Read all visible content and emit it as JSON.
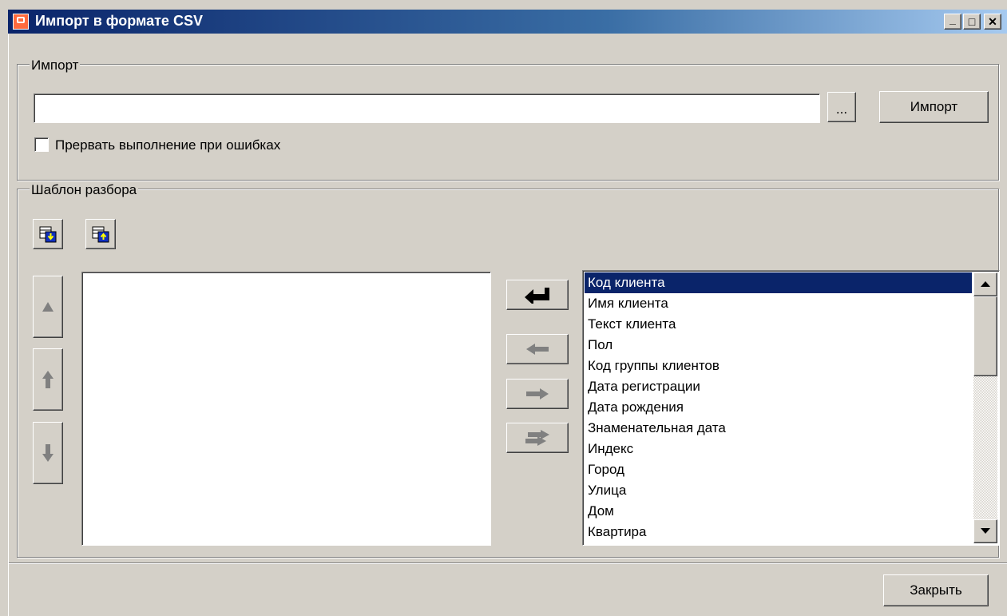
{
  "window": {
    "title": "Импорт в формате CSV",
    "minimize": "_",
    "maximize": "□",
    "close": "✕"
  },
  "import_group": {
    "label": "Импорт",
    "file_path_value": "",
    "browse_label": "...",
    "import_label": "Импорт",
    "abort_on_errors_label": "Прервать выполнение при ошибках",
    "abort_on_errors_checked": false
  },
  "template_group": {
    "label": "Шаблон разбора",
    "load_template_icon": "load-template-icon",
    "save_template_icon": "save-template-icon",
    "selected_fields": [],
    "available_fields": [
      "Код клиента",
      "Имя клиента",
      "Текст клиента",
      "Пол",
      "Код группы клиентов",
      "Дата регистрации",
      "Дата рождения",
      "Знаменательная дата",
      "Индекс",
      "Город",
      "Улица",
      "Дом",
      "Квартира"
    ],
    "selected_available_index": 0
  },
  "footer": {
    "close_label": "Закрыть"
  },
  "colors": {
    "selection": "#0a246a",
    "face": "#d4d0c8",
    "disabled_icon": "#808080"
  }
}
